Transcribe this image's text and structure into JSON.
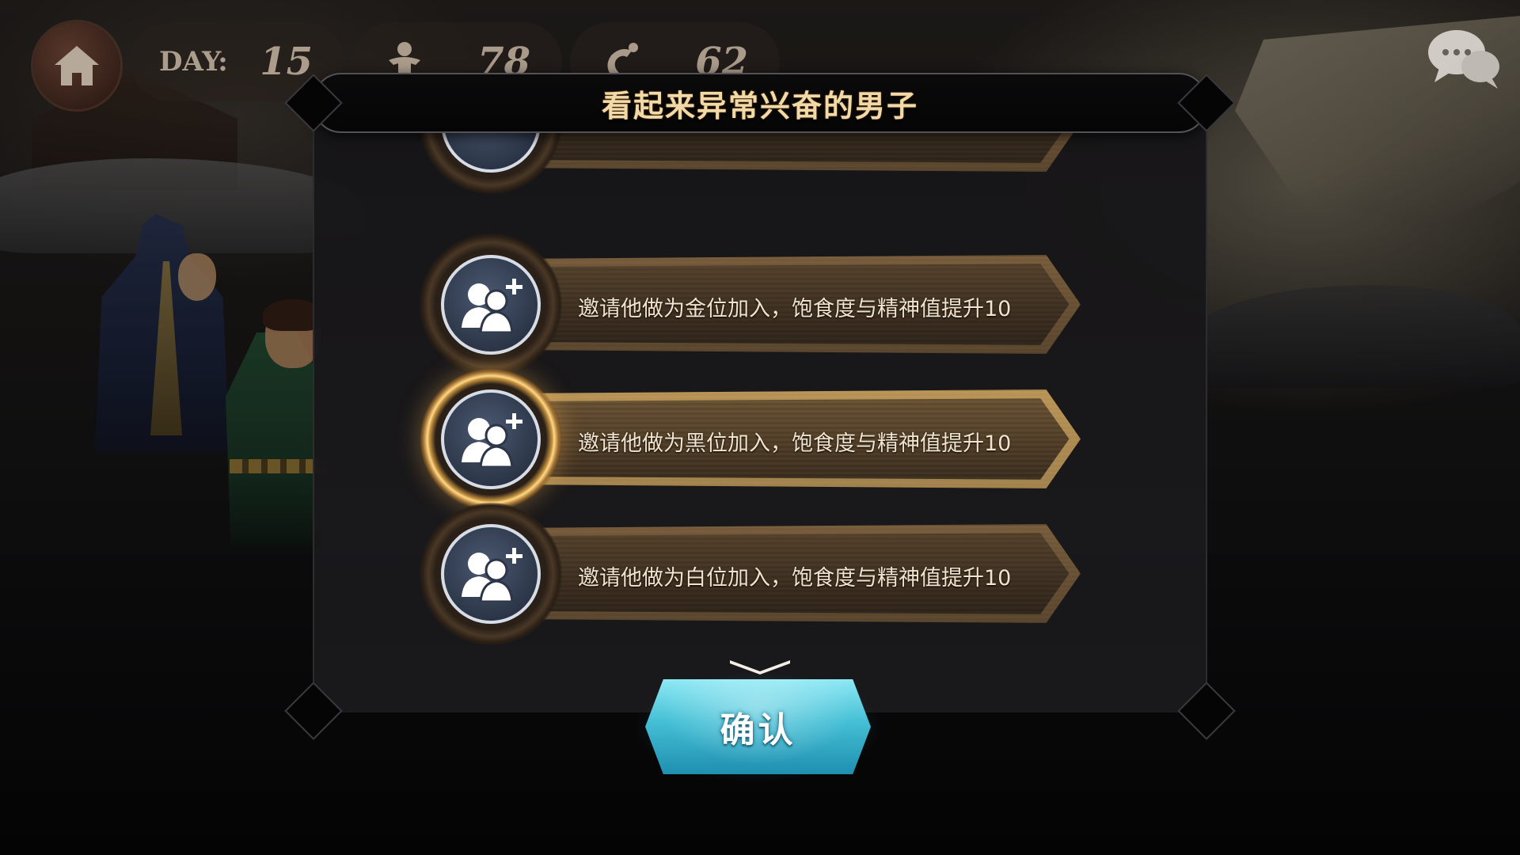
{
  "hud": {
    "day_label": "DAY:",
    "day_value": "15",
    "people_value": "78",
    "food_value": "62"
  },
  "dialog": {
    "title": "看起来异常兴奋的男子",
    "options": [
      {
        "label": "邀请他做为金位加入，饱食度与精神值提升10",
        "selected": false
      },
      {
        "label": "邀请他做为黑位加入，饱食度与精神值提升10",
        "selected": true
      },
      {
        "label": "邀请他做为白位加入，饱食度与精神值提升10",
        "selected": false
      }
    ],
    "confirm_label": "确认"
  },
  "icons": {
    "home": "home-icon",
    "people": "person-icon",
    "food": "food-icon",
    "chat": "chat-bubbles-icon",
    "option": "add-person-icon",
    "scroll": "chevron-down-icon"
  },
  "colors": {
    "title_text": "#f2d9a8",
    "confirm_button": "#44bfd5",
    "selected_ring": "#ffd98a"
  }
}
